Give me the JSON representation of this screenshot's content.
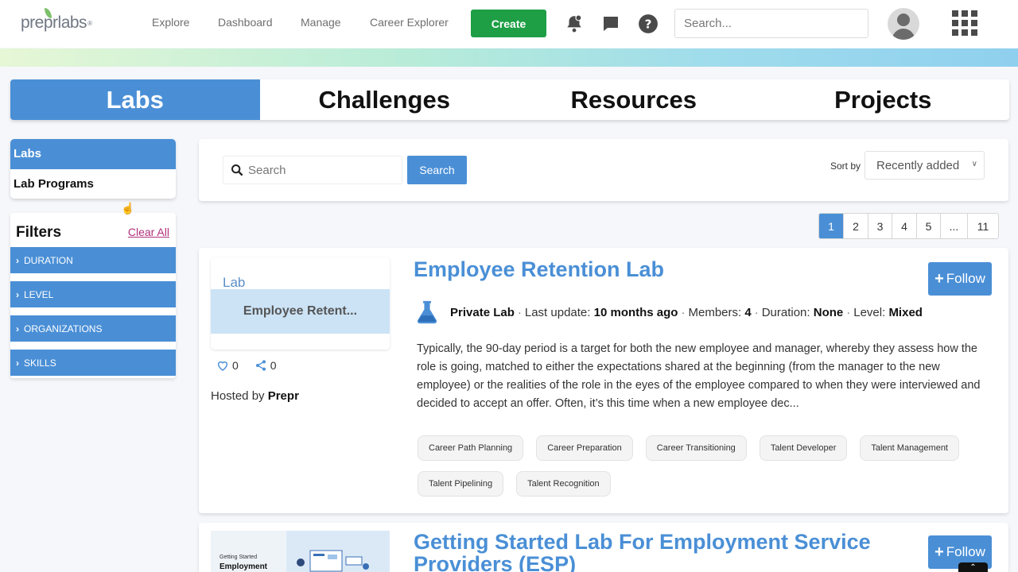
{
  "logo": {
    "text": "preprlabs",
    "mark": "®"
  },
  "nav": {
    "links": [
      "Explore",
      "Dashboard",
      "Manage",
      "Career Explorer"
    ],
    "create_label": "Create",
    "search_placeholder": "Search..."
  },
  "main_tabs": [
    "Labs",
    "Challenges",
    "Resources",
    "Projects"
  ],
  "sidebar": {
    "items": [
      "Labs",
      "Lab Programs"
    ],
    "filters_title": "Filters",
    "clear_all": "Clear All",
    "filters": [
      "DURATION",
      "LEVEL",
      "ORGANIZATIONS",
      "SKILLS"
    ]
  },
  "search": {
    "placeholder": "Search",
    "button_label": "Search",
    "sort_label": "Sort by",
    "sort_value": "Recently added"
  },
  "pagination": [
    "1",
    "2",
    "3",
    "4",
    "5",
    "...",
    "11"
  ],
  "labs": [
    {
      "thumb_type": "Lab",
      "thumb_title": "Employee Retent...",
      "likes": "0",
      "shares": "0",
      "hosted_prefix": "Hosted by",
      "host": "Prepr",
      "title": "Employee Retention Lab",
      "follow_label": "Follow",
      "privacy": "Private Lab",
      "last_update_label": "Last update:",
      "last_update": "10 months ago",
      "members_label": "Members:",
      "members": "4",
      "duration_label": "Duration:",
      "duration": "None",
      "level_label": "Level:",
      "level": "Mixed",
      "description": "Typically, the 90-day period is a target for both the new employee and manager, whereby they assess how the role is going, matched to either the expectations shared at the beginning (from the manager to the new employee) or the realities of the role in the eyes of the employee compared to when they were interviewed and decided to accept an offer. Often, it’s this time when a new employee dec...",
      "tags": [
        "Career Path Planning",
        "Career Preparation",
        "Career Transitioning",
        "Talent Developer",
        "Talent Management",
        "Talent Pipelining",
        "Talent Recognition"
      ]
    },
    {
      "thumb_line1": "Getting Started",
      "thumb_line2": "Employment",
      "title": "Getting Started Lab For Employment Service Providers (ESP)",
      "follow_label": "Follow"
    }
  ],
  "colors": {
    "primary": "#4a8fd6",
    "create_green": "#1e9e45",
    "clear_all": "#b0307a"
  }
}
